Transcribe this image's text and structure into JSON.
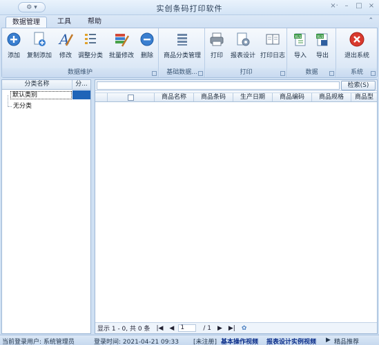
{
  "window": {
    "title": "实创条码打印软件"
  },
  "ribbon_tabs": [
    {
      "label": "数据管理"
    },
    {
      "label": "工具"
    },
    {
      "label": "帮助"
    }
  ],
  "ribbon_groups": {
    "data_maintenance": {
      "label": "数据维护",
      "buttons": [
        {
          "label": "添加"
        },
        {
          "label": "复制添加"
        },
        {
          "label": "修改"
        },
        {
          "label": "调整分类"
        },
        {
          "label": "批量修改"
        },
        {
          "label": "删除"
        }
      ]
    },
    "base_data": {
      "label": "基础数据...",
      "buttons": [
        {
          "label": "商品分类管理"
        }
      ]
    },
    "print": {
      "label": "打印",
      "buttons": [
        {
          "label": "打印"
        },
        {
          "label": "报表设计"
        },
        {
          "label": "打印日志"
        }
      ]
    },
    "data": {
      "label": "数据",
      "buttons": [
        {
          "label": "导入"
        },
        {
          "label": "导出"
        }
      ]
    },
    "system": {
      "label": "系统",
      "buttons": [
        {
          "label": "退出系统"
        }
      ]
    }
  },
  "category_panel": {
    "columns": [
      "分类名称",
      "分..."
    ],
    "items": [
      "默认类别",
      "无分类"
    ]
  },
  "search": {
    "button_label": "检索(S)",
    "value": ""
  },
  "grid": {
    "columns": [
      "商品名称",
      "商品条码",
      "生产日期",
      "商品编码",
      "商品规格",
      "商品型"
    ]
  },
  "pager": {
    "summary": "显示 1 - 0, 共 0 条",
    "current_page": "1",
    "total_pages": "/ 1"
  },
  "status": {
    "user": "当前登录用户: 系统管理员",
    "login_time": "登录时间: 2021-04-21 09:33",
    "registration": "[未注册]",
    "link1": "基本操作视频",
    "link2": "报表设计实例视频",
    "link3": "精品推荐"
  },
  "colors": {
    "accent": "#1f4e8c",
    "ribbon_bg": "#dfeaf7",
    "selected_cell": "#1e64b8"
  }
}
